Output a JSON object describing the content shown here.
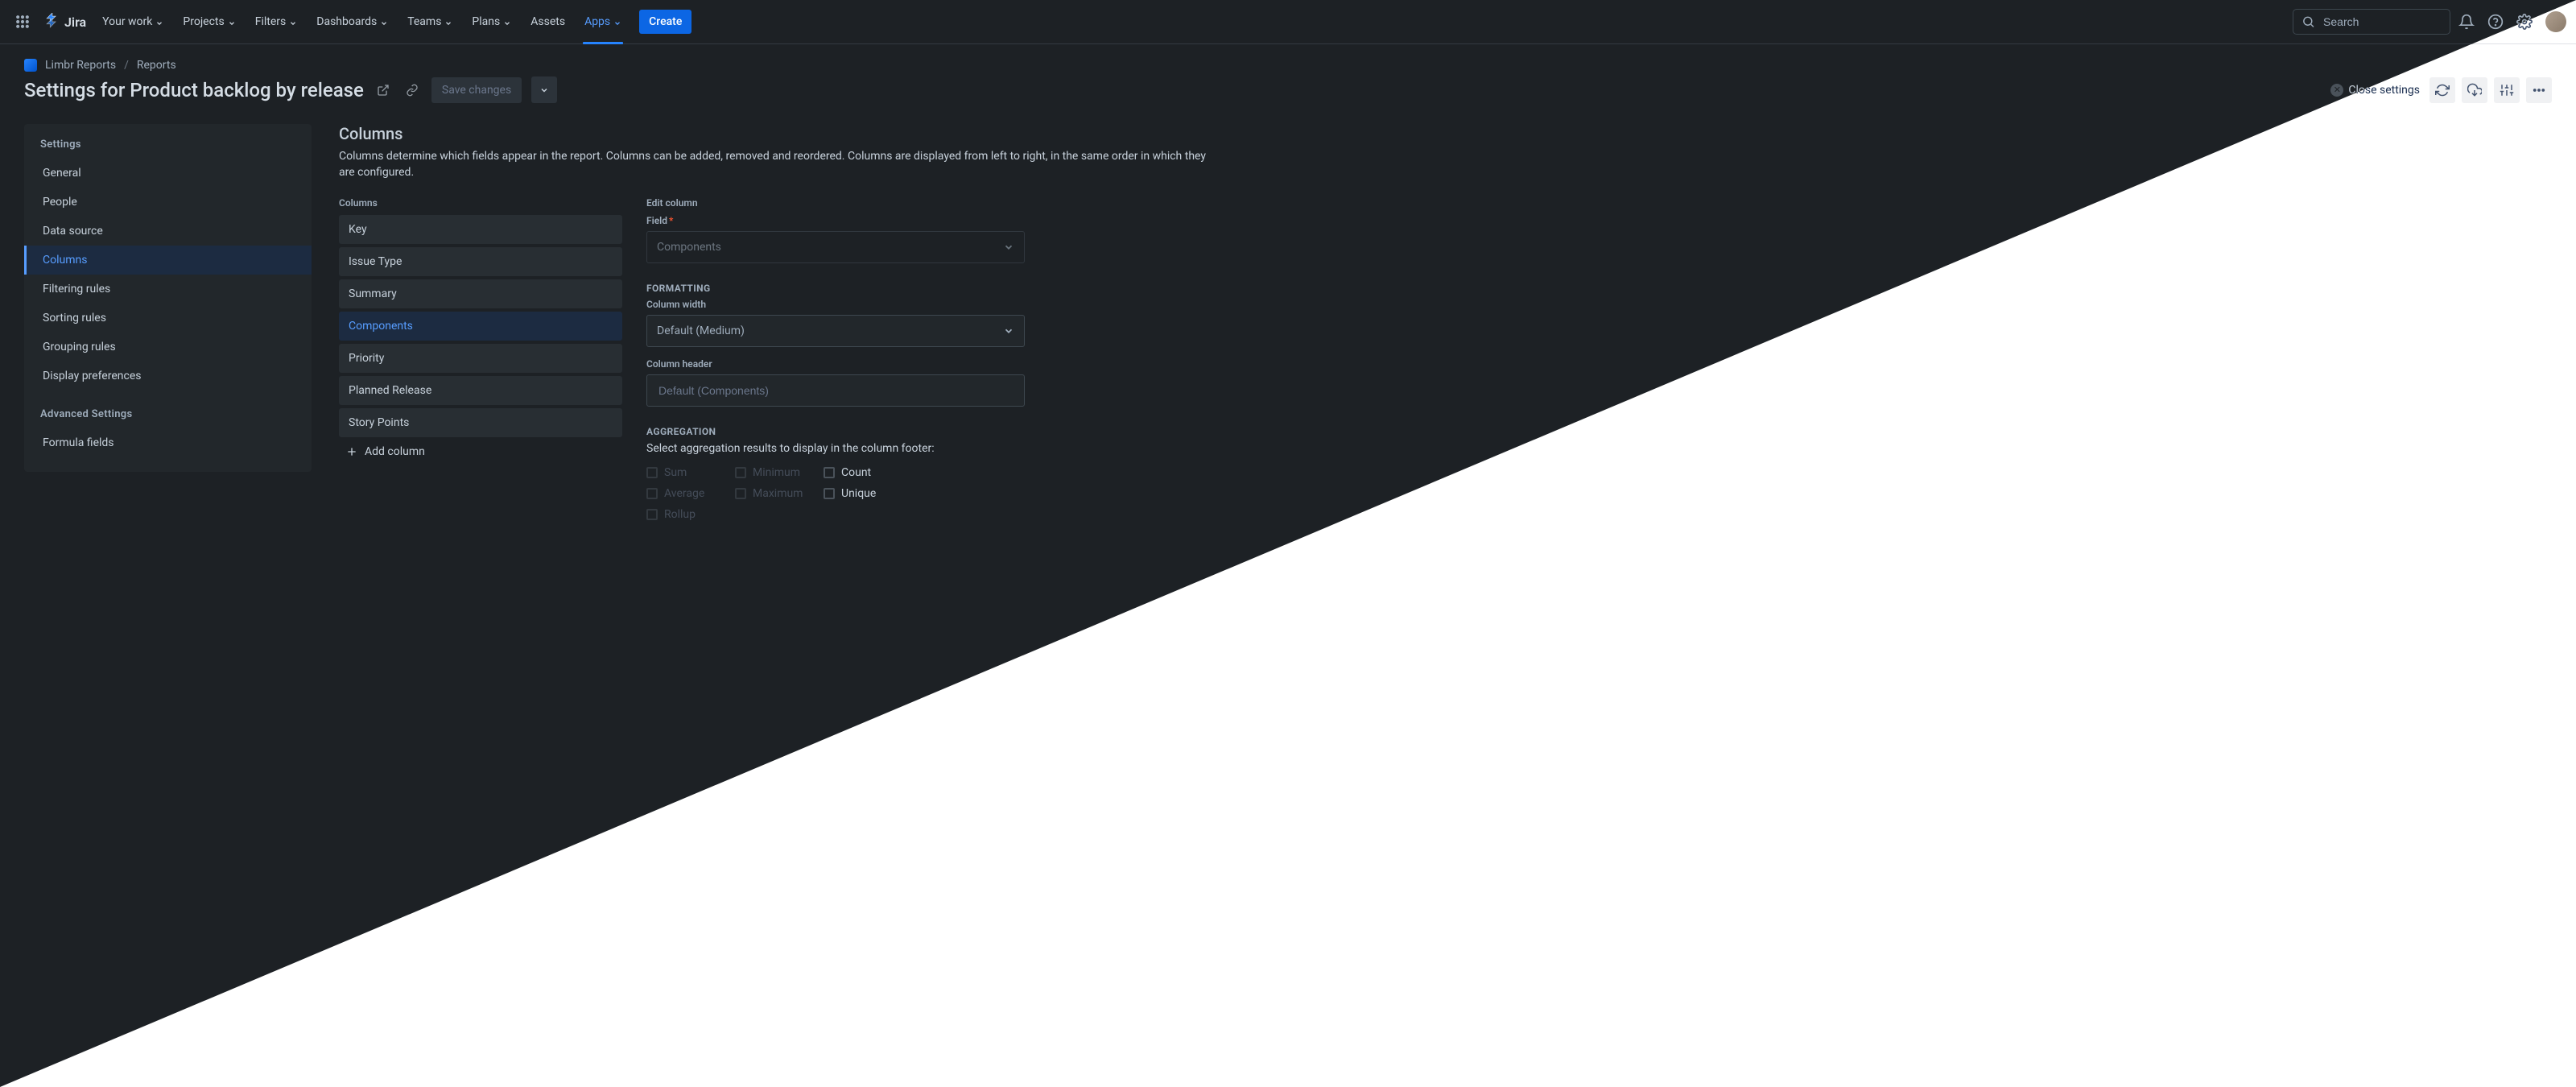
{
  "nav": {
    "items": [
      "Your work",
      "Projects",
      "Filters",
      "Dashboards",
      "Teams",
      "Plans",
      "Assets",
      "Apps"
    ],
    "create": "Create",
    "search_placeholder": "Search"
  },
  "breadcrumbs": {
    "project": "Limbr Reports",
    "page": "Reports"
  },
  "title": "Settings for Product backlog by release",
  "save": "Save changes",
  "close_settings": "Close settings",
  "sidebar": {
    "heading": "Settings",
    "items": [
      "General",
      "People",
      "Data source",
      "Columns",
      "Filtering rules",
      "Sorting rules",
      "Grouping rules",
      "Display preferences"
    ],
    "advanced_heading": "Advanced Settings",
    "advanced_items": [
      "Formula fields"
    ]
  },
  "columns": {
    "section_title": "Columns",
    "section_desc": "Columns determine which fields appear in the report. Columns can be added, removed and reordered. Columns are displayed from left to right, in the same order in which they are configured.",
    "list_heading": "Columns",
    "items": [
      "Key",
      "Issue Type",
      "Summary",
      "Components",
      "Priority",
      "Planned Release",
      "Story Points"
    ],
    "add": "Add column"
  },
  "edit": {
    "heading": "Edit column",
    "field_label": "Field",
    "field_value": "Components",
    "formatting_heading": "FORMATTING",
    "width_label": "Column width",
    "width_value": "Default (Medium)",
    "header_label": "Column header",
    "header_placeholder": "Default (Components)",
    "aggregation_heading": "AGGREGATION",
    "aggregation_desc": "Select aggregation results to display in the column footer:",
    "checks": {
      "sum": "Sum",
      "average": "Average",
      "rollup": "Rollup",
      "minimum": "Minimum",
      "maximum": "Maximum",
      "count": "Count",
      "unique": "Unique"
    }
  }
}
